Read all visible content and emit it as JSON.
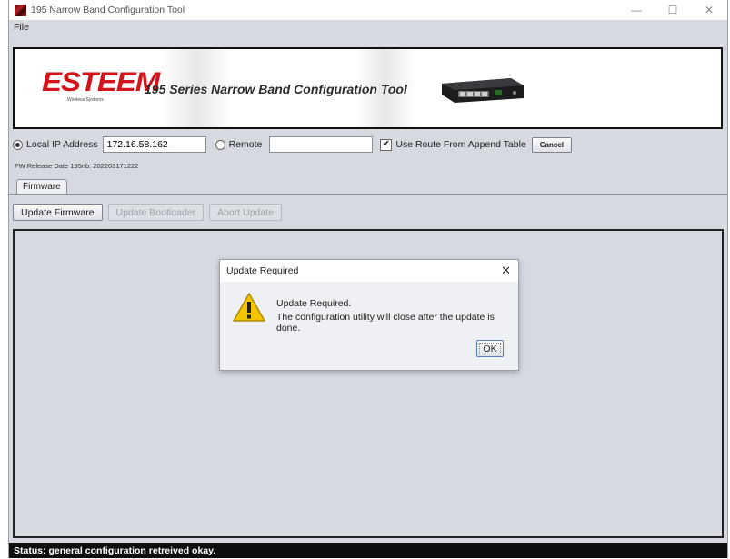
{
  "window": {
    "title": "195 Narrow Band Configuration Tool",
    "minimize_glyph": "—",
    "maximize_glyph": "☐",
    "close_glyph": "✕"
  },
  "menu": {
    "file_label": "File"
  },
  "banner": {
    "logo_text": "ESTEEM",
    "logo_sub": "Wireless Systems",
    "title": "195 Series Narrow Band Configuration Tool"
  },
  "connection": {
    "local_label": "Local IP Address",
    "local_ip": "172.16.58.162",
    "remote_label": "Remote",
    "remote_value": "",
    "route_label": "Use Route From Append Table",
    "route_checked": true,
    "cancel_label": "Cancel"
  },
  "fw_info": "FW Release Date 195nb: 202203171222",
  "tabs": {
    "firmware": "Firmware"
  },
  "toolbar": {
    "update_firmware": "Update Firmware",
    "update_bootloader": "Update Bootloader",
    "abort_update": "Abort Update"
  },
  "dialog": {
    "title": "Update Required",
    "close_glyph": "✕",
    "message_line1": "Update Required.",
    "message_line2": "The configuration utility will close after the update is done.",
    "ok_label": "OK"
  },
  "status": "Status: general configuration retreived okay.",
  "colors": {
    "brand_red": "#d3141c",
    "window_bg": "#d6d9e0",
    "status_bg": "#0e0e0e",
    "warning_yellow": "#f5c400"
  }
}
